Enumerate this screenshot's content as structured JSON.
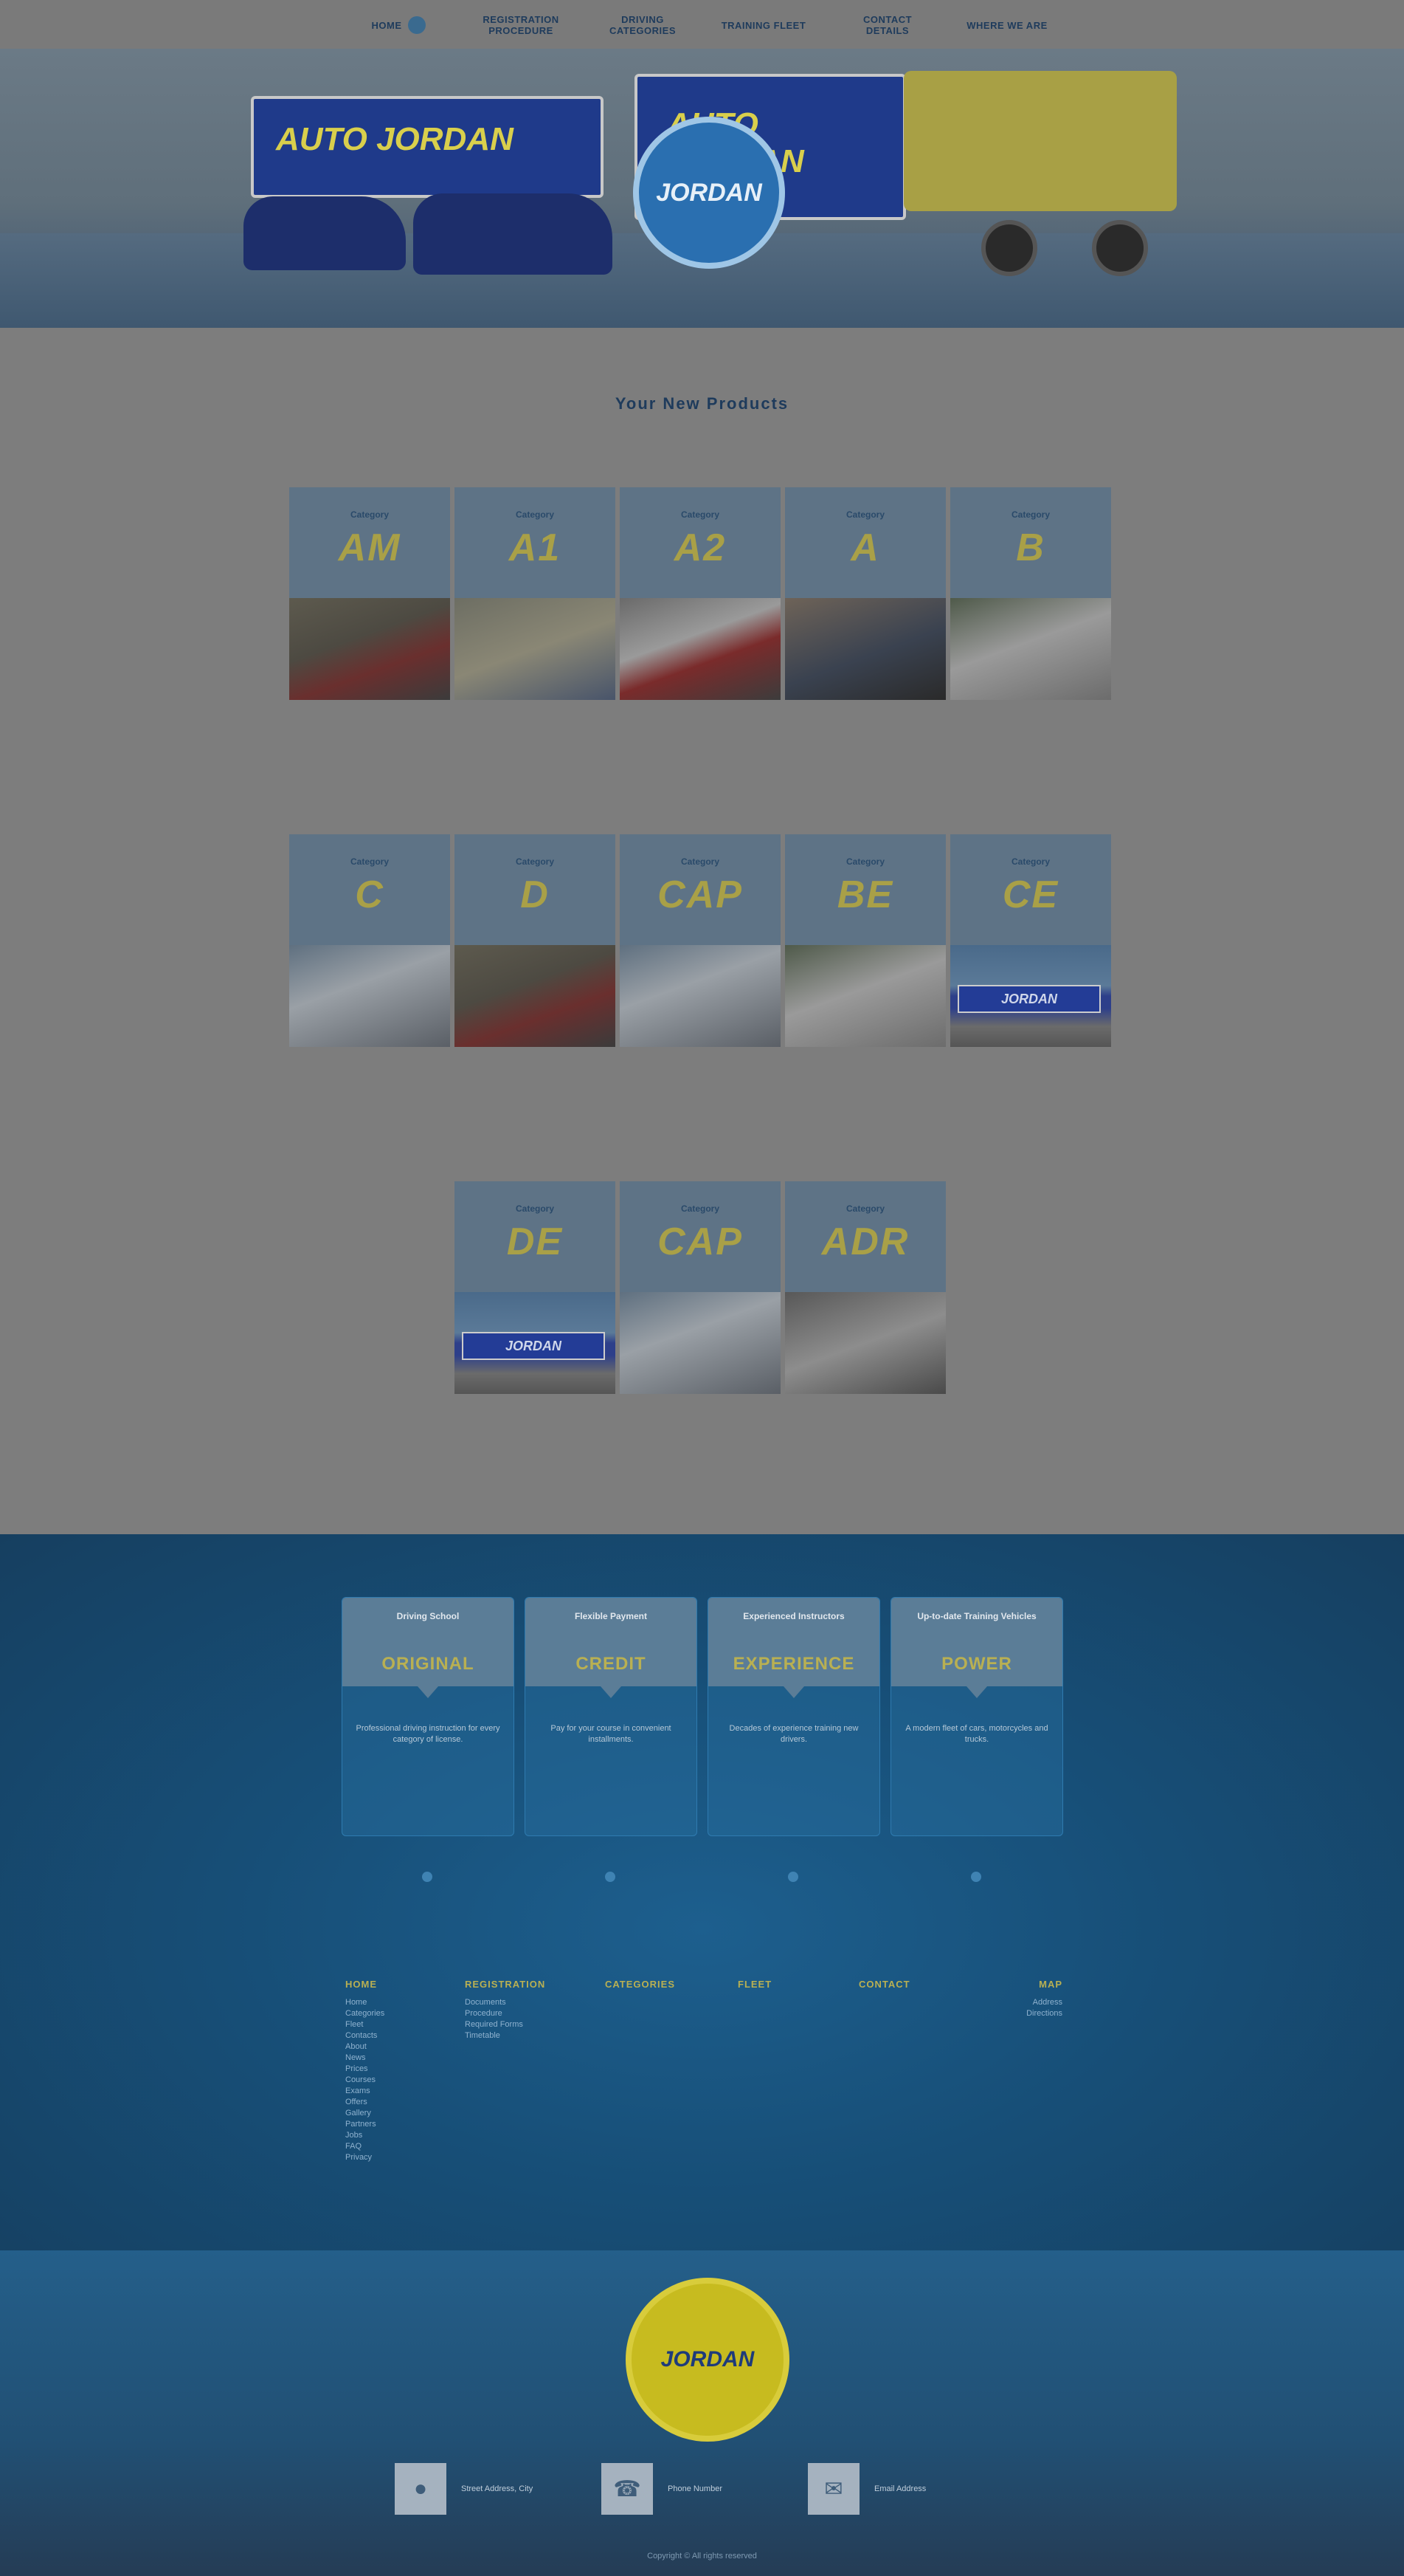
{
  "nav": [
    {
      "label": "Home",
      "icon": "home-icon"
    },
    {
      "label": "Registration Procedure"
    },
    {
      "label": "Driving Categories"
    },
    {
      "label": "Training Fleet"
    },
    {
      "label": "Contact Details"
    },
    {
      "label": "Where We Are"
    }
  ],
  "hero": {
    "banner_text": "AUTO JORDAN",
    "badge_text": "JORDAN"
  },
  "section_title": "Your New Products",
  "cards": [
    {
      "caption": "Category",
      "code": "AM",
      "photo": "scooter"
    },
    {
      "caption": "Category",
      "code": "A1",
      "photo": "moped"
    },
    {
      "caption": "Category",
      "code": "A2",
      "photo": "bike"
    },
    {
      "caption": "Category",
      "code": "A",
      "photo": "sport"
    },
    {
      "caption": "Category",
      "code": "B",
      "photo": "car"
    },
    {
      "caption": "Category",
      "code": "C",
      "photo": "truck"
    },
    {
      "caption": "Category",
      "code": "D",
      "photo": "scooter"
    },
    {
      "caption": "Category",
      "code": "CAP",
      "photo": "truck"
    },
    {
      "caption": "Category",
      "code": "BE",
      "photo": "car"
    },
    {
      "caption": "Category",
      "code": "CE",
      "photo": "trailer"
    },
    {
      "caption": "Category",
      "code": "DE",
      "photo": "trailer"
    },
    {
      "caption": "Category",
      "code": "CAP",
      "photo": "truck"
    },
    {
      "caption": "Category",
      "code": "ADR",
      "photo": "lorry"
    }
  ],
  "promos": [
    {
      "caption": "Driving School",
      "word": "ORIGINAL",
      "text": "Professional driving instruction for every category of license."
    },
    {
      "caption": "Flexible Payment",
      "word": "CREDIT",
      "text": "Pay for your course in convenient installments."
    },
    {
      "caption": "Experienced Instructors",
      "word": "EXPERIENCE",
      "text": "Decades of experience training new drivers."
    },
    {
      "caption": "Up-to-date Training Vehicles",
      "word": "POWER",
      "text": "A modern fleet of cars, motorcycles and trucks."
    }
  ],
  "footer_cols": [
    {
      "head": "Home",
      "items": [
        "Home",
        "Categories",
        "Fleet",
        "Contacts",
        "About",
        "News",
        "Prices",
        "Courses",
        "Exams",
        "Offers",
        "Gallery",
        "Partners",
        "Jobs",
        "FAQ",
        "Privacy"
      ]
    },
    {
      "head": "Registration",
      "items": [
        "Documents",
        "Procedure",
        "Required Forms",
        "Timetable"
      ]
    },
    {
      "head": "Categories",
      "items": []
    },
    {
      "head": "Fleet",
      "items": []
    },
    {
      "head": "Contact",
      "items": []
    },
    {
      "head": "Map",
      "items": [
        "Address",
        "Directions"
      ]
    }
  ],
  "footer": {
    "logo_text": "JORDAN",
    "contacts": [
      {
        "icon": "location-icon",
        "text": "Street Address, City"
      },
      {
        "icon": "phone-icon",
        "text": "Phone Number"
      },
      {
        "icon": "mail-icon",
        "text": "Email Address"
      }
    ],
    "copyright": "Copyright © All rights reserved"
  }
}
